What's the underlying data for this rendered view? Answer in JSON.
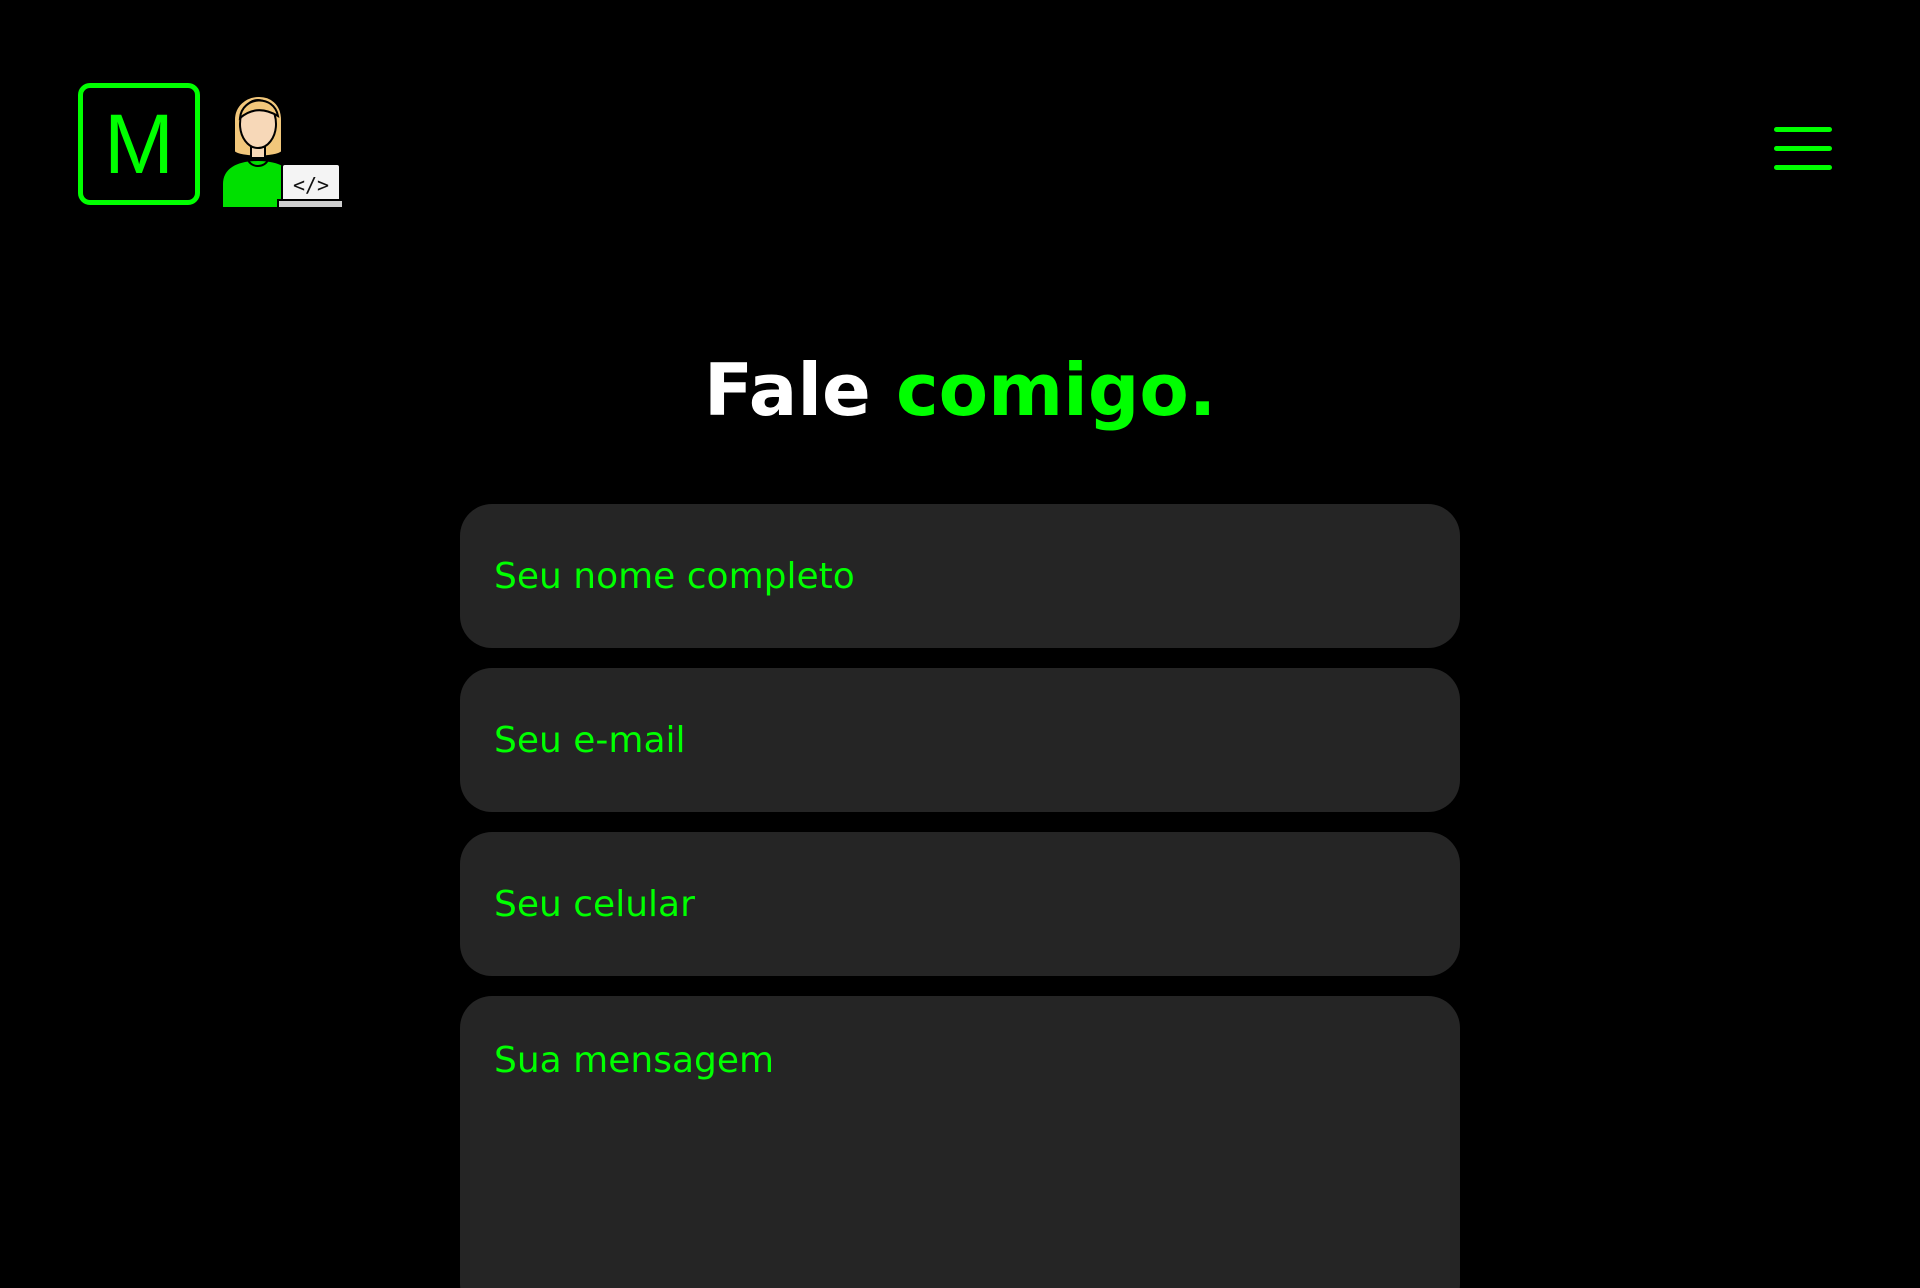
{
  "header": {
    "logo_letter": "M",
    "avatar_icon": "developer-avatar-icon",
    "menu_icon": "hamburger-menu-icon"
  },
  "title": {
    "part1": "Fale",
    "part2": "comigo."
  },
  "form": {
    "name_placeholder": "Seu nome completo",
    "email_placeholder": "Seu e-mail",
    "phone_placeholder": "Seu celular",
    "message_placeholder": "Sua mensagem"
  },
  "colors": {
    "background": "#000000",
    "accent": "#00ff00",
    "field_bg": "#252525",
    "title_white": "#ffffff"
  }
}
